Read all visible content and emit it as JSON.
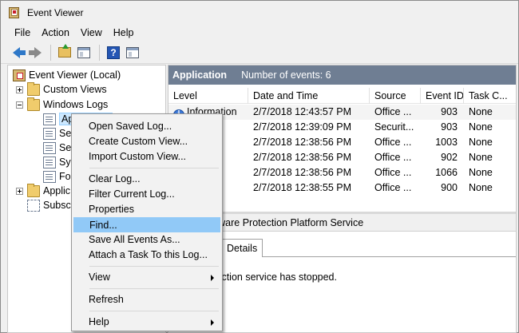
{
  "window": {
    "title": "Event Viewer"
  },
  "menubar": [
    {
      "label": "File"
    },
    {
      "label": "Action"
    },
    {
      "label": "View"
    },
    {
      "label": "Help"
    }
  ],
  "toolbar": {
    "icons": [
      "back-arrow-icon",
      "forward-arrow-icon",
      "folder-up-icon",
      "show-hide-tree-icon",
      "help-icon",
      "action-pane-icon"
    ]
  },
  "tree": {
    "root": "Event Viewer (Local)",
    "custom_views": "Custom Views",
    "windows_logs": "Windows Logs",
    "application": "Application",
    "security": "Sec",
    "setup": "Set",
    "system": "Sys",
    "forwarded": "For",
    "apps_services": "Applic",
    "subscriptions": "Subscr"
  },
  "content": {
    "title": "Application",
    "count_label": "Number of events: 6"
  },
  "grid": {
    "columns": [
      "Level",
      "Date and Time",
      "Source",
      "Event ID",
      "Task C..."
    ],
    "rows": [
      {
        "level": "Information",
        "date": "2/7/2018 12:43:57 PM",
        "source": "Office ...",
        "id": "903",
        "task": "None"
      },
      {
        "level": "ation",
        "date": "2/7/2018 12:39:09 PM",
        "source": "Securit...",
        "id": "903",
        "task": "None"
      },
      {
        "level": "ation",
        "date": "2/7/2018 12:38:56 PM",
        "source": "Office ...",
        "id": "1003",
        "task": "None"
      },
      {
        "level": "ation",
        "date": "2/7/2018 12:38:56 PM",
        "source": "Office ...",
        "id": "902",
        "task": "None"
      },
      {
        "level": "ation",
        "date": "2/7/2018 12:38:56 PM",
        "source": "Office ...",
        "id": "1066",
        "task": "None"
      },
      {
        "level": "ation",
        "date": "2/7/2018 12:38:55 PM",
        "source": "Office ...",
        "id": "900",
        "task": "None"
      }
    ]
  },
  "detail": {
    "title": "Office Software Protection Platform Service",
    "tab_details": "Details",
    "body": "ware Protection service has stopped."
  },
  "context_menu": {
    "open_saved_log": "Open Saved Log...",
    "create_custom_view": "Create Custom View...",
    "import_custom_view": "Import Custom View...",
    "clear_log": "Clear Log...",
    "filter_current_log": "Filter Current Log...",
    "properties": "Properties",
    "find": "Find...",
    "save_all_events": "Save All Events As...",
    "attach_task": "Attach a Task To this Log...",
    "view": "View",
    "refresh": "Refresh",
    "help": "Help"
  },
  "colors": {
    "header_bg": "#6f7e93",
    "highlight": "#91c9f7",
    "tree_selection": "#cce8ff"
  }
}
